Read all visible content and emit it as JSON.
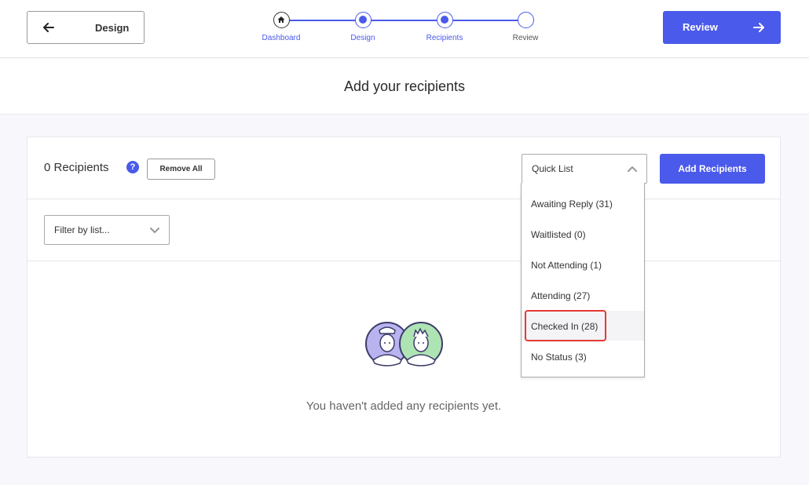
{
  "header": {
    "back_label": "Design",
    "review_label": "Review",
    "steps": [
      {
        "label": "Dashboard",
        "state": "done"
      },
      {
        "label": "Design",
        "state": "active"
      },
      {
        "label": "Recipients",
        "state": "active"
      },
      {
        "label": "Review",
        "state": "todo"
      }
    ]
  },
  "page": {
    "title": "Add your recipients"
  },
  "recipients": {
    "count_label": "0 Recipients",
    "help_glyph": "?",
    "remove_all_label": "Remove All",
    "add_label": "Add Recipients",
    "quick_list_label": "Quick List",
    "filter_placeholder": "Filter by list...",
    "empty_message": "You haven't added any recipients yet."
  },
  "dropdown": {
    "items": [
      {
        "label": "Awaiting Reply (31)"
      },
      {
        "label": "Waitlisted (0)"
      },
      {
        "label": "Not Attending (1)"
      },
      {
        "label": "Attending (27)"
      },
      {
        "label": "Checked In (28)"
      },
      {
        "label": "No Status (3)"
      }
    ],
    "highlighted_index": 4
  },
  "colors": {
    "accent": "#4a5aeb",
    "highlight": "#e53935"
  }
}
